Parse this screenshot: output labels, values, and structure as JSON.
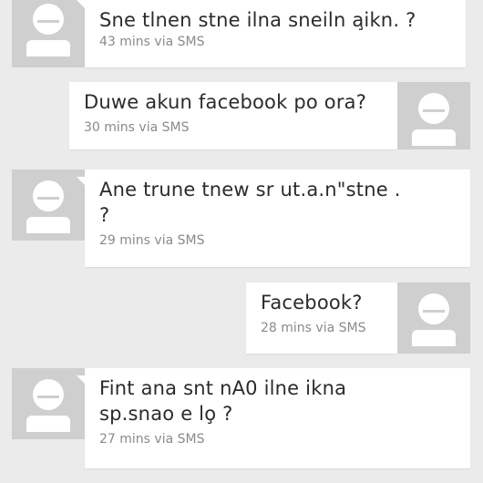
{
  "messages": [
    {
      "direction": "incoming",
      "text": "Sne tlnen stne ilna sneiln a̧ikn. ?",
      "meta": "43 mins via SMS"
    },
    {
      "direction": "outgoing",
      "text": "Duwe akun facebook po ora?",
      "meta": "30 mins via SMS"
    },
    {
      "direction": "incoming",
      "text": "Ane trune tnew sr ut.a.n\"stne . ?",
      "meta": "29 mins via SMS"
    },
    {
      "direction": "outgoing",
      "text": "Facebook?",
      "meta": "28 mins via SMS"
    },
    {
      "direction": "incoming",
      "text": "Fint ana snt nA0 ilne ikna sp.snao e lo̧ ?",
      "meta": "27 mins via SMS"
    }
  ],
  "icons": {
    "avatar": "default-contact-avatar-icon"
  },
  "colors": {
    "background": "#ebebeb",
    "bubble": "#ffffff",
    "avatar_bg": "#cfcfcf",
    "text": "#2b2b2b",
    "meta": "#8a8a8a"
  }
}
